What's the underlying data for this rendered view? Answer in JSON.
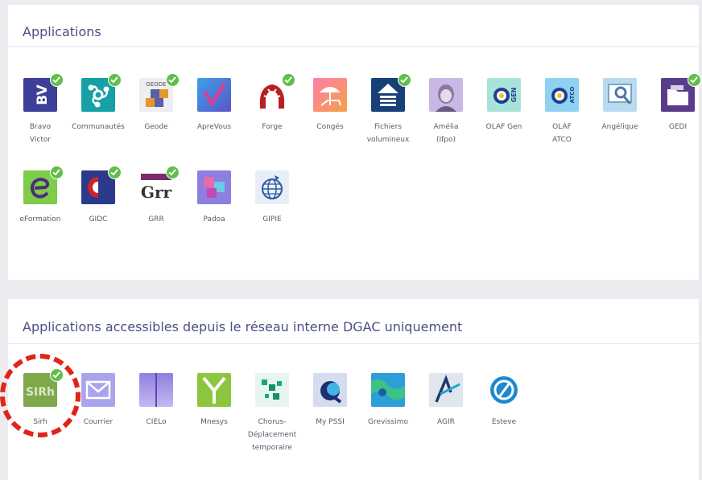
{
  "section1": {
    "title": "Applications",
    "apps": [
      {
        "label": "Bravo\nVictor",
        "icon": "bravo-victor-icon",
        "check": true
      },
      {
        "label": "Communautés",
        "icon": "communautes-icon",
        "check": true
      },
      {
        "label": "Geode",
        "icon": "geode-icon",
        "check": true
      },
      {
        "label": "ApreVous",
        "icon": "aprevous-icon",
        "check": false
      },
      {
        "label": "Forge",
        "icon": "forge-icon",
        "check": true
      },
      {
        "label": "Congés",
        "icon": "conges-icon",
        "check": false
      },
      {
        "label": "Fichiers\nvolumineux",
        "icon": "fichiers-volumineux-icon",
        "check": true
      },
      {
        "label": "Amélia\n(Ifpo)",
        "icon": "amelia-icon",
        "check": false
      },
      {
        "label": "OLAF Gen",
        "icon": "olaf-gen-icon",
        "check": false
      },
      {
        "label": "OLAF\nATCO",
        "icon": "olaf-atco-icon",
        "check": false
      },
      {
        "label": "Angélique",
        "icon": "angelique-icon",
        "check": false
      },
      {
        "label": "GEDI",
        "icon": "gedi-icon",
        "check": true
      },
      {
        "label": "eFormation",
        "icon": "eformation-icon",
        "check": true
      },
      {
        "label": "GIDC",
        "icon": "gidc-icon",
        "check": true
      },
      {
        "label": "GRR",
        "icon": "grr-icon",
        "check": true
      },
      {
        "label": "Padoa",
        "icon": "padoa-icon",
        "check": false
      },
      {
        "label": "GIPIE",
        "icon": "gipie-icon",
        "check": false
      }
    ]
  },
  "section2": {
    "title": "Applications accessibles depuis le réseau interne DGAC uniquement",
    "apps": [
      {
        "label": "Sirh",
        "icon": "sirh-icon",
        "check": true
      },
      {
        "label": "Courrier",
        "icon": "courrier-icon",
        "check": false
      },
      {
        "label": "CIELo",
        "icon": "cielo-icon",
        "check": false
      },
      {
        "label": "Mnesys",
        "icon": "mnesys-icon",
        "check": false
      },
      {
        "label": "Chorus-\nDéplacement\ntemporaire",
        "icon": "chorus-icon",
        "check": false
      },
      {
        "label": "My PSSI",
        "icon": "my-pssi-icon",
        "check": false
      },
      {
        "label": "Grevissimo",
        "icon": "grevissimo-icon",
        "check": false
      },
      {
        "label": "AGIR",
        "icon": "agir-icon",
        "check": false
      },
      {
        "label": "Esteve",
        "icon": "esteve-icon",
        "check": false
      }
    ]
  },
  "tile_text": {
    "bv": "BV",
    "geode": "GEODE",
    "gen": "GEN",
    "atco": "ATCO",
    "grr": "Grr",
    "sirh": "SIRh"
  }
}
